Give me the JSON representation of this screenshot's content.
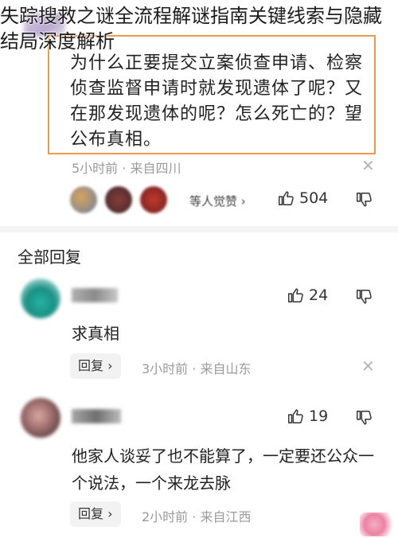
{
  "overlay_title": "失踪搜救之谜全流程解谜指南关键线索与隐藏结局深度解析",
  "quoted_comment": {
    "text": "为什么正要提交立案侦查申请、检察侦查监督申请时就发现遗体了呢？又在那发现遗体的呢？怎么死亡的？望公布真相。",
    "time": "5小时前",
    "location": "来自四川",
    "close_icon": "close-icon",
    "reactors_text": "等人觉赞 ›",
    "likes": "504"
  },
  "section": {
    "title": "全部回复"
  },
  "comments": [
    {
      "text": "求真相",
      "likes": "24",
      "reply_label": "回复 ›",
      "time": "3小时前",
      "location": "来自山东",
      "avatar_color": "#26b3a3"
    },
    {
      "text": "他家人谈妥了也不能算了，一定要还公众一个说法，一个来龙去脉",
      "likes": "19",
      "reply_label": "回复 ›",
      "time": "2小时前",
      "location": "来自江西",
      "avatar_color": "#9c6b6b"
    }
  ],
  "separator": "·",
  "colors": {
    "quote_border": "#e89b4a",
    "meta_gray": "#9a9a9a",
    "reply_bg": "#f2f2f2"
  },
  "icons": {
    "like": "thumbs-up-icon",
    "dislike": "thumbs-down-icon",
    "close": "close-icon"
  }
}
